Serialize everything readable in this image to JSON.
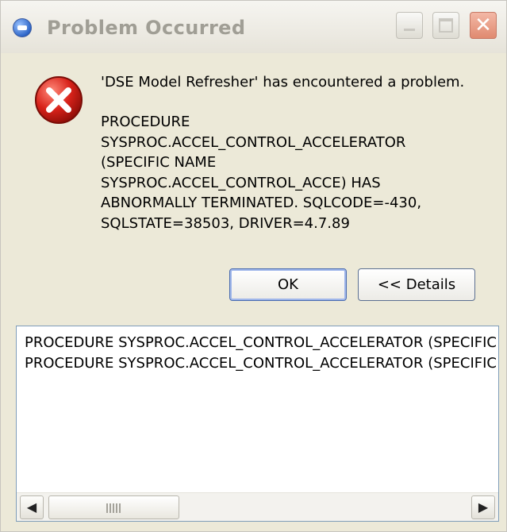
{
  "window": {
    "title": "Problem Occurred",
    "controls": {
      "minimize": "minimize",
      "maximize": "maximize",
      "close": "✕"
    }
  },
  "message": {
    "headline": "'DSE Model Refresher' has encountered a problem.",
    "body_lines": [
      "PROCEDURE",
      "SYSPROC.ACCEL_CONTROL_ACCELERATOR",
      "(SPECIFIC NAME",
      "SYSPROC.ACCEL_CONTROL_ACCE) HAS",
      "ABNORMALLY TERMINATED. SQLCODE=-430,",
      "SQLSTATE=38503, DRIVER=4.7.89"
    ]
  },
  "buttons": {
    "ok": "OK",
    "details": "<< Details"
  },
  "details": {
    "lines": [
      "PROCEDURE SYSPROC.ACCEL_CONTROL_ACCELERATOR (SPECIFIC NAME",
      "PROCEDURE SYSPROC.ACCEL_CONTROL_ACCELERATOR (SPECIFIC NAME"
    ]
  },
  "icons": {
    "app": "app-icon",
    "error": "error-icon",
    "scroll_left": "arrow-left-icon",
    "scroll_right": "arrow-right-icon"
  },
  "colors": {
    "error_red": "#d8221a",
    "accent": "#4a6cb0"
  }
}
